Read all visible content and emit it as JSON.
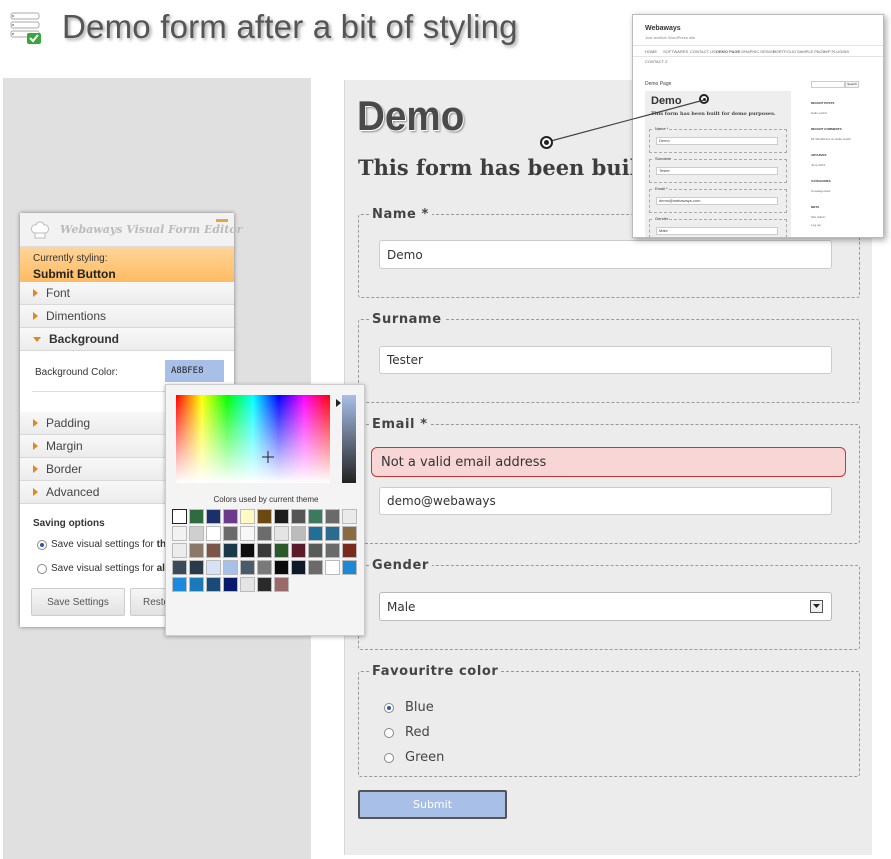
{
  "header": {
    "title": "Demo form after a bit of styling"
  },
  "form": {
    "heading": "Demo",
    "subheading": "This form has been built for demo purposes.",
    "fields": {
      "name": {
        "label": "Name *",
        "value": "Demo"
      },
      "surname": {
        "label": "Surname",
        "value": "Tester"
      },
      "email": {
        "label": "Email *",
        "error": "Not a valid email address",
        "value": "demo@webaways"
      },
      "gender": {
        "label": "Gender",
        "value": "Male"
      },
      "color": {
        "label": "Favouritre color",
        "options": [
          "Blue",
          "Red",
          "Green"
        ],
        "selected": "Blue"
      }
    },
    "submit_label": "Submit"
  },
  "editor": {
    "title": "Webaways Visual Form Editor",
    "currently_label": "Currently styling:",
    "currently_value": "Submit Button",
    "sections": [
      "Font",
      "Dimentions",
      "Background",
      "Padding",
      "Margin",
      "Border",
      "Advanced"
    ],
    "open_section": "Background",
    "bg_color_label": "Background Color:",
    "bg_color_value": "A8BFE8",
    "saving_title": "Saving options",
    "save_opt1_prefix": "Save visual settings for ",
    "save_opt1_bold": "this",
    "save_opt2_prefix": "Save visual settings for ",
    "save_opt2_bold": "all",
    "save_button": "Save Settings",
    "reset_button": "Resto"
  },
  "picker": {
    "label": "Colors used by current theme",
    "current_color": "#a8bfe8",
    "swatches": [
      "#ffffff",
      "#2e6b3e",
      "#1a2f6b",
      "#6b3a8a",
      "#fff9c4",
      "#6b4a12",
      "#1c1c1c",
      "#555555",
      "#3b7a5e",
      "#6a6a6a",
      "#eaeaea",
      "#f2f2f2",
      "#cfcfcf",
      "#ffffff",
      "#6a6a6a",
      "#f7f7f7",
      "#6c6c6c",
      "#e4e4e4",
      "#bcbcbc",
      "#1f6f9a",
      "#2a6b8f",
      "#8a6a40",
      "#ececec",
      "#8a7868",
      "#7a5648",
      "#1a3a4a",
      "#0e0e0e",
      "#3a3a3a",
      "#2a5a2a",
      "#5a1a2a",
      "#5a5a5a",
      "#6a6a6a",
      "#7a2a1a",
      "#3a4a5a",
      "#2a3a4a",
      "#d7e2f7",
      "#a8bfe8",
      "#4a5a6a",
      "#7a7a7a",
      "#0a0a0a",
      "#0e1a2a",
      "#6a6a6a",
      "#ffffff",
      "#1a8ad8",
      "#1a8ae0",
      "#1a7ab8",
      "#1a4a7a",
      "#0a1a6a",
      "#e4e4e4",
      "#2a2a2a",
      "#9a6a6a"
    ]
  },
  "preview": {
    "site_title": "Webaways",
    "tagline": "Just another WordPress site",
    "nav": [
      "HOME",
      "SOFTWARES",
      "CONTACT US",
      "DEMO PAGE",
      "GRAPHIC DESIGN",
      "PORTFOLIO",
      "SAMPLE PAGE",
      "WP PLUGINS"
    ],
    "contact": "CONTACT 2",
    "page_title": "Demo Page",
    "demo_heading": "Demo",
    "demo_sub": "This form has been built for demo purposes.",
    "fields": [
      {
        "label": "Name *",
        "value": "Demo"
      },
      {
        "label": "Surname",
        "value": "Tester"
      },
      {
        "label": "Email *",
        "value": "demo@webaways.com"
      },
      {
        "label": "Gender",
        "value": "Male"
      }
    ],
    "search_btn": "Search",
    "side": [
      "RECENT POSTS",
      "Hello world!",
      "RECENT COMMENTS",
      "Mr WordPress on Hello world!",
      "ARCHIVES",
      "June 2013",
      "CATEGORIES",
      "Uncategorized",
      "META",
      "Site Admin",
      "Log out"
    ]
  }
}
